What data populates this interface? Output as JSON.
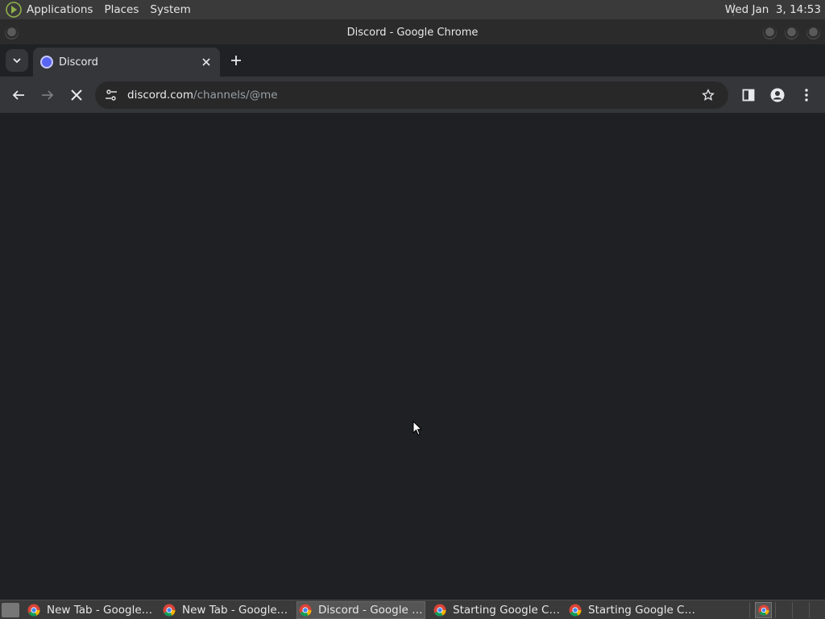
{
  "top_panel": {
    "menu": [
      "Applications",
      "Places",
      "System"
    ],
    "clock": "Wed Jan  3, 14:53"
  },
  "window": {
    "title": "Discord - Google Chrome"
  },
  "browser": {
    "tab_title": "Discord",
    "url_host": "discord.com",
    "url_path": "/channels/@me"
  },
  "taskbar": {
    "items": [
      {
        "label": "New Tab - Google ...",
        "active": false
      },
      {
        "label": "New Tab - Google ...",
        "active": false
      },
      {
        "label": "Discord - Google C...",
        "active": true
      },
      {
        "label": "Starting Google Chr...",
        "active": false
      },
      {
        "label": "Starting Google Chr...",
        "active": false
      }
    ]
  },
  "colors": {
    "content_bg": "#1f2023",
    "toolbar_bg": "#35363a",
    "discord_blurple": "#5865f2"
  }
}
